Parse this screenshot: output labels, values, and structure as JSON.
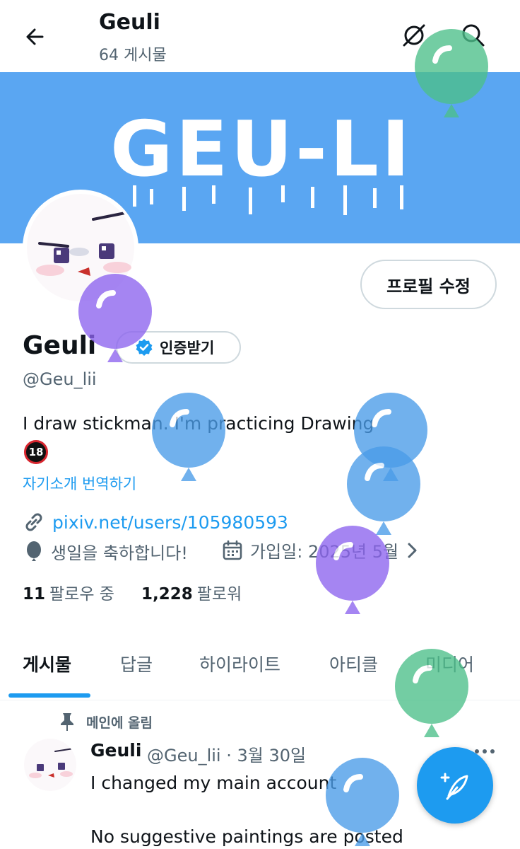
{
  "header": {
    "title": "Geuli",
    "post_count": "64 게시물"
  },
  "banner": {
    "text": "GEU-LI",
    "color": "#5aa6f2"
  },
  "edit_profile_label": "프로필 수정",
  "profile": {
    "name": "Geuli",
    "verify_label": "인증받기",
    "handle": "@Geu_lii",
    "bio": "I draw stickman. I'm practicing Drawing",
    "age_badge": "18",
    "translate_label": "자기소개 번역하기",
    "link": "pixiv.net/users/105980593",
    "birthday": "생일을 축하합니다!",
    "joined": "가입일: 2025년 5월",
    "following_count": "11",
    "following_label": "팔로우 중",
    "followers_count": "1,228",
    "followers_label": "팔로워"
  },
  "tabs": [
    {
      "label": "게시물",
      "active": true
    },
    {
      "label": "답글",
      "active": false
    },
    {
      "label": "하이라이트",
      "active": false
    },
    {
      "label": "아티클",
      "active": false
    },
    {
      "label": "미디어",
      "active": false
    }
  ],
  "pinned_post": {
    "pinned_label": "메인에 올림",
    "author": "Geuli",
    "handle_date": "@Geu_lii · 3월 30일",
    "line1": "I changed my main account",
    "line2": "No suggestive paintings are posted"
  },
  "colors": {
    "accent": "#1d9bf0",
    "balloon_green": "#4cc08a",
    "balloon_purple": "#8c63ef",
    "balloon_blue": "#4a9ce8"
  }
}
